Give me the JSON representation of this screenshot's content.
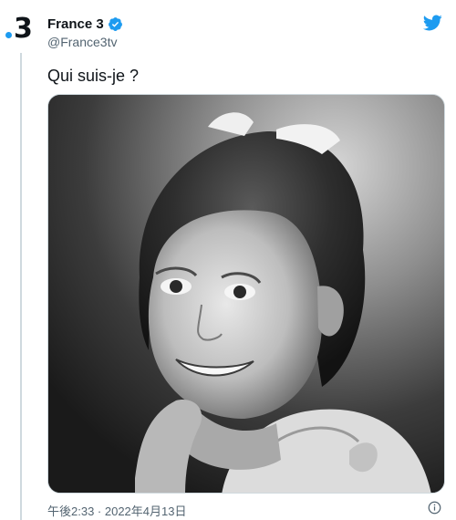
{
  "account": {
    "display_name": "France 3",
    "handle": "@France3tv",
    "avatar_text": "3",
    "verified": true
  },
  "tweet": {
    "text": "Qui suis-je ?",
    "timestamp": "午後2:33 · 2022年4月13日",
    "media_alt": "Black and white portrait of a smiling young girl with hair tied in a bow"
  },
  "icons": {
    "verified": "verified-badge-icon",
    "brand": "twitter-bird-icon",
    "info": "info-icon"
  },
  "colors": {
    "accent": "#1d9bf0",
    "text": "#0f1419",
    "secondary": "#536471"
  }
}
